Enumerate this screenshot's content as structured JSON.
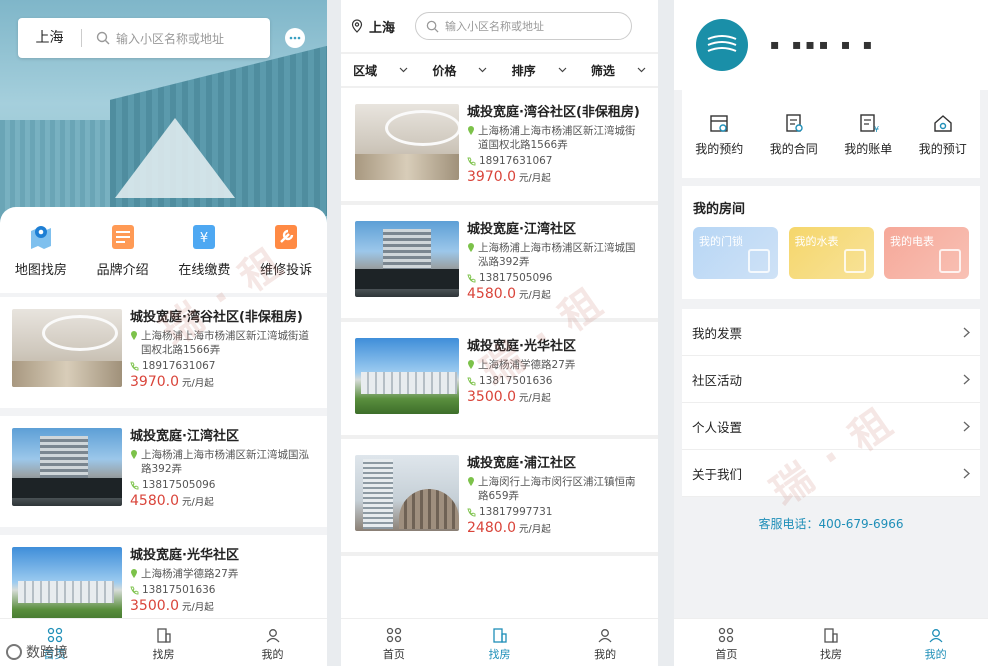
{
  "accent_color": "#1f8fb8",
  "price_color": "#d9443a",
  "panel1": {
    "city": "上海",
    "search_placeholder": "输入小区名称或地址",
    "quick": [
      {
        "label": "地图找房",
        "icon": "map-pin-icon"
      },
      {
        "label": "品牌介绍",
        "icon": "brand-icon"
      },
      {
        "label": "在线缴费",
        "icon": "payment-icon"
      },
      {
        "label": "维修投诉",
        "icon": "repair-icon"
      }
    ],
    "listings": [
      {
        "title": "城投宽庭·湾谷社区(非保租房)",
        "address": "上海杨浦上海市杨浦区新江湾城街道国权北路1566弄",
        "phone": "18917631067",
        "price": "3970.0",
        "unit": "元/月起"
      },
      {
        "title": "城投宽庭·江湾社区",
        "address": "上海杨浦上海市杨浦区新江湾城国泓路392弄",
        "phone": "13817505096",
        "price": "4580.0",
        "unit": "元/月起",
        "sign": "成投宽庭"
      },
      {
        "title": "城投宽庭·光华社区",
        "address": "上海杨浦学德路27弄",
        "phone": "13817501636",
        "price": "3500.0",
        "unit": "元/月起"
      }
    ],
    "tabs": [
      {
        "label": "首页",
        "icon": "home-icon"
      },
      {
        "label": "找房",
        "icon": "building-icon"
      },
      {
        "label": "我的",
        "icon": "user-icon"
      }
    ],
    "logo_text": "数跨境"
  },
  "panel2": {
    "city": "上海",
    "search_placeholder": "输入小区名称或地址",
    "filters": [
      "区域",
      "价格",
      "排序",
      "筛选"
    ],
    "listings": [
      {
        "title": "城投宽庭·湾谷社区(非保租房)",
        "address": "上海杨浦上海市杨浦区新江湾城街道国权北路1566弄",
        "phone": "18917631067",
        "price": "3970.0",
        "unit": "元/月起"
      },
      {
        "title": "城投宽庭·江湾社区",
        "address": "上海杨浦上海市杨浦区新江湾城国泓路392弄",
        "phone": "13817505096",
        "price": "4580.0",
        "unit": "元/月起",
        "sign": "成投宽庭"
      },
      {
        "title": "城投宽庭·光华社区",
        "address": "上海杨浦学德路27弄",
        "phone": "13817501636",
        "price": "3500.0",
        "unit": "元/月起"
      },
      {
        "title": "城投宽庭·浦江社区",
        "address": "上海闵行上海市闵行区浦江镇恒南路659弄",
        "phone": "13817997731",
        "price": "2480.0",
        "unit": "元/月起"
      }
    ],
    "tabs": [
      {
        "label": "首页",
        "icon": "home-icon"
      },
      {
        "label": "找房",
        "icon": "building-icon"
      },
      {
        "label": "我的",
        "icon": "user-icon"
      }
    ]
  },
  "panel3": {
    "username": "▪ ▪▪▪ ▪ ▪",
    "menu": [
      {
        "label": "我的预约",
        "icon": "calendar-icon"
      },
      {
        "label": "我的合同",
        "icon": "contract-icon"
      },
      {
        "label": "我的账单",
        "icon": "bill-icon"
      },
      {
        "label": "我的预订",
        "icon": "reservation-icon"
      }
    ],
    "rooms_title": "我的房间",
    "room_tiles": [
      {
        "label": "我的门锁",
        "icon": "door-lock-icon"
      },
      {
        "label": "我的水表",
        "icon": "water-meter-icon"
      },
      {
        "label": "我的电表",
        "icon": "electric-meter-icon"
      }
    ],
    "rows": [
      "我的发票",
      "社区活动",
      "个人设置",
      "关于我们"
    ],
    "hotline": "客服电话：400-679-6966",
    "tabs": [
      {
        "label": "首页",
        "icon": "home-icon"
      },
      {
        "label": "找房",
        "icon": "building-icon"
      },
      {
        "label": "我的",
        "icon": "user-icon"
      }
    ]
  }
}
